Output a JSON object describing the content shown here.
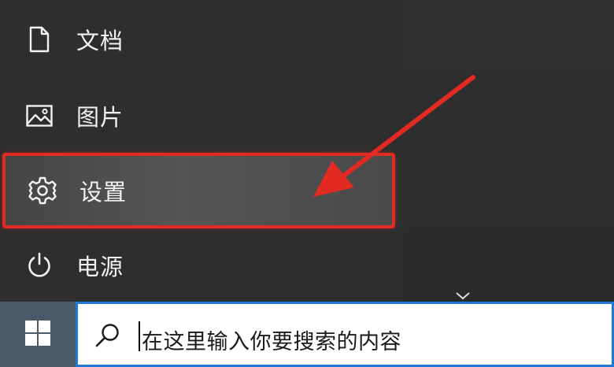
{
  "start_menu": {
    "items": [
      {
        "label": "文档",
        "icon": "document-icon"
      },
      {
        "label": "图片",
        "icon": "picture-icon"
      },
      {
        "label": "设置",
        "icon": "gear-icon",
        "highlighted": true
      },
      {
        "label": "电源",
        "icon": "power-icon"
      }
    ],
    "expand_icon": "chevron-down-icon"
  },
  "annotation": {
    "color": "#e02a22",
    "arrow_target": "设置"
  },
  "taskbar": {
    "start_icon": "windows-logo-icon",
    "search": {
      "icon": "search-icon",
      "placeholder": "在这里输入你要搜索的内容"
    }
  },
  "colors": {
    "menu_background": "#2e2e2e",
    "taskbar_background": "#33393f",
    "start_button": "#4a5a68",
    "search_border": "#1e78d7",
    "highlight_border": "#e02a22"
  }
}
